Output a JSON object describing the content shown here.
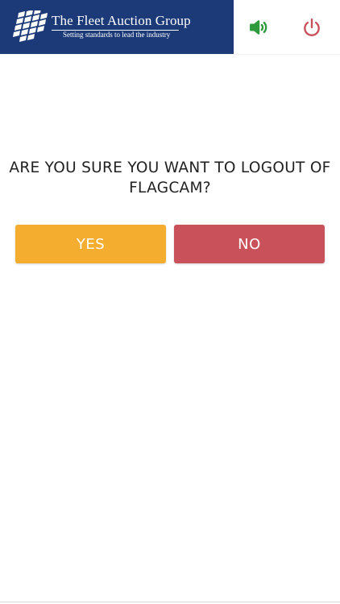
{
  "header": {
    "brand_name": "The Fleet Auction Group",
    "brand_tagline": "Setting standards to lead the industry",
    "sound_icon": "speaker-volume-icon",
    "power_icon": "power-icon"
  },
  "dialog": {
    "question_line1": "ARE YOU SURE YOU WANT TO LOGOUT OF",
    "question_line2": "FLAGCAM?",
    "yes_label": "YES",
    "no_label": "NO"
  },
  "colors": {
    "header_bg": "#1c3a78",
    "sound_icon": "#2e9a3c",
    "power_icon": "#c9525a",
    "yes_button": "#f4ad2e",
    "no_button": "#c9525a"
  }
}
